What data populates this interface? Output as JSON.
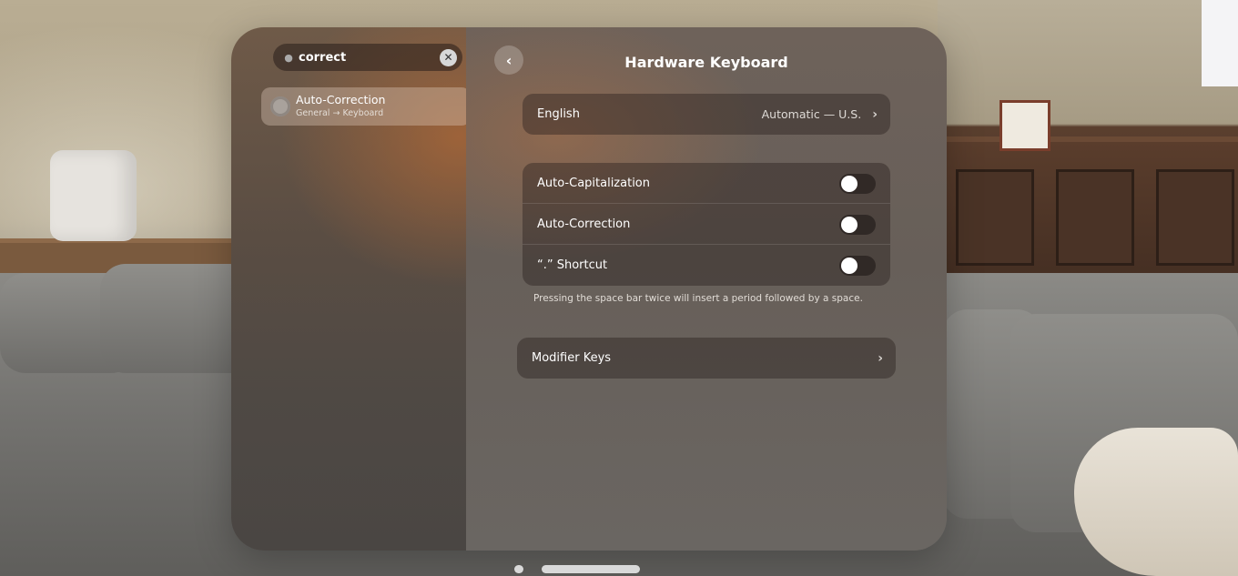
{
  "sidebar": {
    "search": {
      "value": "correct"
    },
    "result": {
      "title": "Auto-Correction",
      "path": "General → Keyboard"
    }
  },
  "detail": {
    "title": "Hardware Keyboard",
    "language": {
      "label": "English",
      "value": "Automatic — U.S."
    },
    "toggles": [
      {
        "label": "Auto-Capitalization",
        "on": false
      },
      {
        "label": "Auto-Correction",
        "on": false
      },
      {
        "label": "“.” Shortcut",
        "on": false
      }
    ],
    "footnote": "Pressing the space bar twice will insert a period followed by a space.",
    "modifier_keys": {
      "label": "Modifier Keys"
    }
  },
  "icons": {
    "mic": "microphone-icon",
    "clear": "clear-x-icon",
    "back": "chevron-left-icon",
    "chevron": "chevron-right-icon"
  }
}
